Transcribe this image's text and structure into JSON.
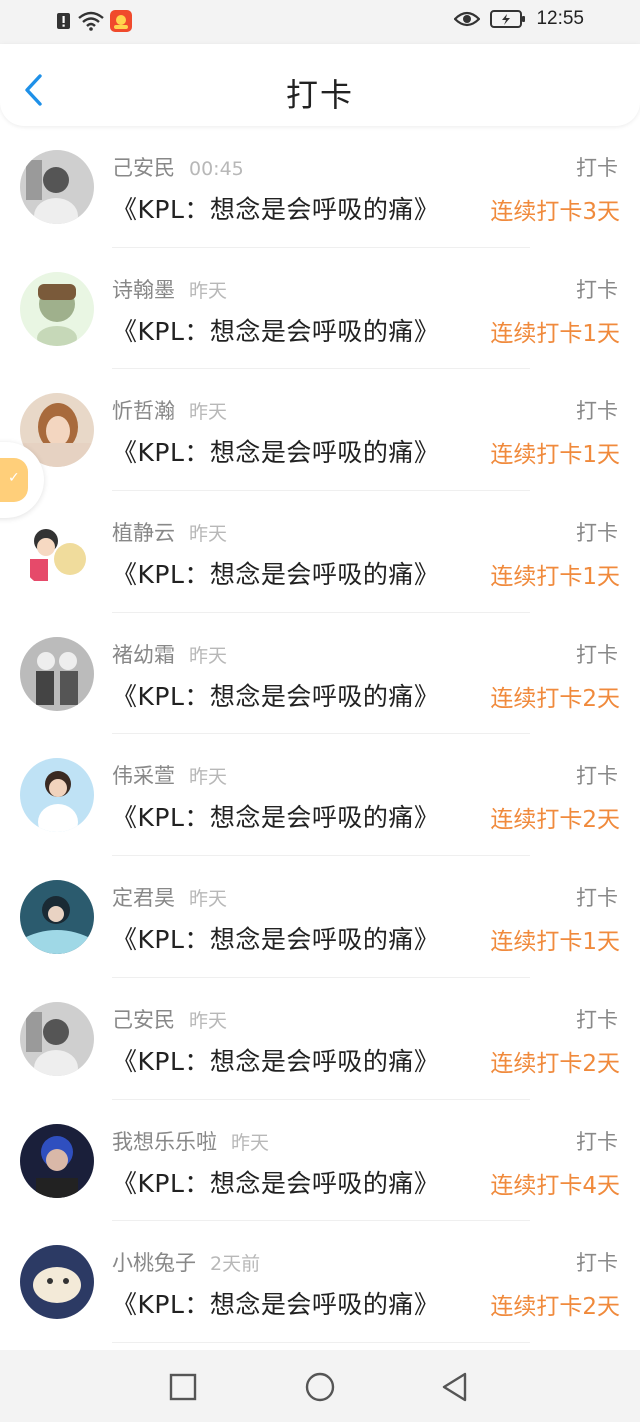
{
  "status_bar": {
    "time": "12:55",
    "icons": [
      "alert-icon",
      "wifi-icon",
      "app-notification-icon",
      "eye-icon",
      "battery-icon"
    ]
  },
  "header": {
    "title": "打卡",
    "back_icon": "chevron-left-icon"
  },
  "colors": {
    "accent_blue": "#1e90e8",
    "streak_orange": "#f08a3c",
    "name_gray": "#888888",
    "time_gray": "#b8b8b8"
  },
  "entries": [
    {
      "name": "己安民",
      "time": "00:45",
      "tag": "打卡",
      "book": "《KPL：想念是会呼吸的痛》",
      "streak": "连续打卡3天"
    },
    {
      "name": "诗翰墨",
      "time": "昨天",
      "tag": "打卡",
      "book": "《KPL：想念是会呼吸的痛》",
      "streak": "连续打卡1天"
    },
    {
      "name": "忻哲瀚",
      "time": "昨天",
      "tag": "打卡",
      "book": "《KPL：想念是会呼吸的痛》",
      "streak": "连续打卡1天"
    },
    {
      "name": "植静云",
      "time": "昨天",
      "tag": "打卡",
      "book": "《KPL：想念是会呼吸的痛》",
      "streak": "连续打卡1天"
    },
    {
      "name": "褚幼霜",
      "time": "昨天",
      "tag": "打卡",
      "book": "《KPL：想念是会呼吸的痛》",
      "streak": "连续打卡2天"
    },
    {
      "name": "伟采萱",
      "time": "昨天",
      "tag": "打卡",
      "book": "《KPL：想念是会呼吸的痛》",
      "streak": "连续打卡2天"
    },
    {
      "name": "定君昊",
      "time": "昨天",
      "tag": "打卡",
      "book": "《KPL：想念是会呼吸的痛》",
      "streak": "连续打卡1天"
    },
    {
      "name": "己安民",
      "time": "昨天",
      "tag": "打卡",
      "book": "《KPL：想念是会呼吸的痛》",
      "streak": "连续打卡2天"
    },
    {
      "name": "我想乐乐啦",
      "time": "昨天",
      "tag": "打卡",
      "book": "《KPL：想念是会呼吸的痛》",
      "streak": "连续打卡4天"
    },
    {
      "name": "小桃兔子",
      "time": "2天前",
      "tag": "打卡",
      "book": "《KPL：想念是会呼吸的痛》",
      "streak": "连续打卡2天"
    }
  ],
  "nav_bar": {
    "icons": [
      "recent-apps-icon",
      "home-icon",
      "back-triangle-icon"
    ]
  }
}
